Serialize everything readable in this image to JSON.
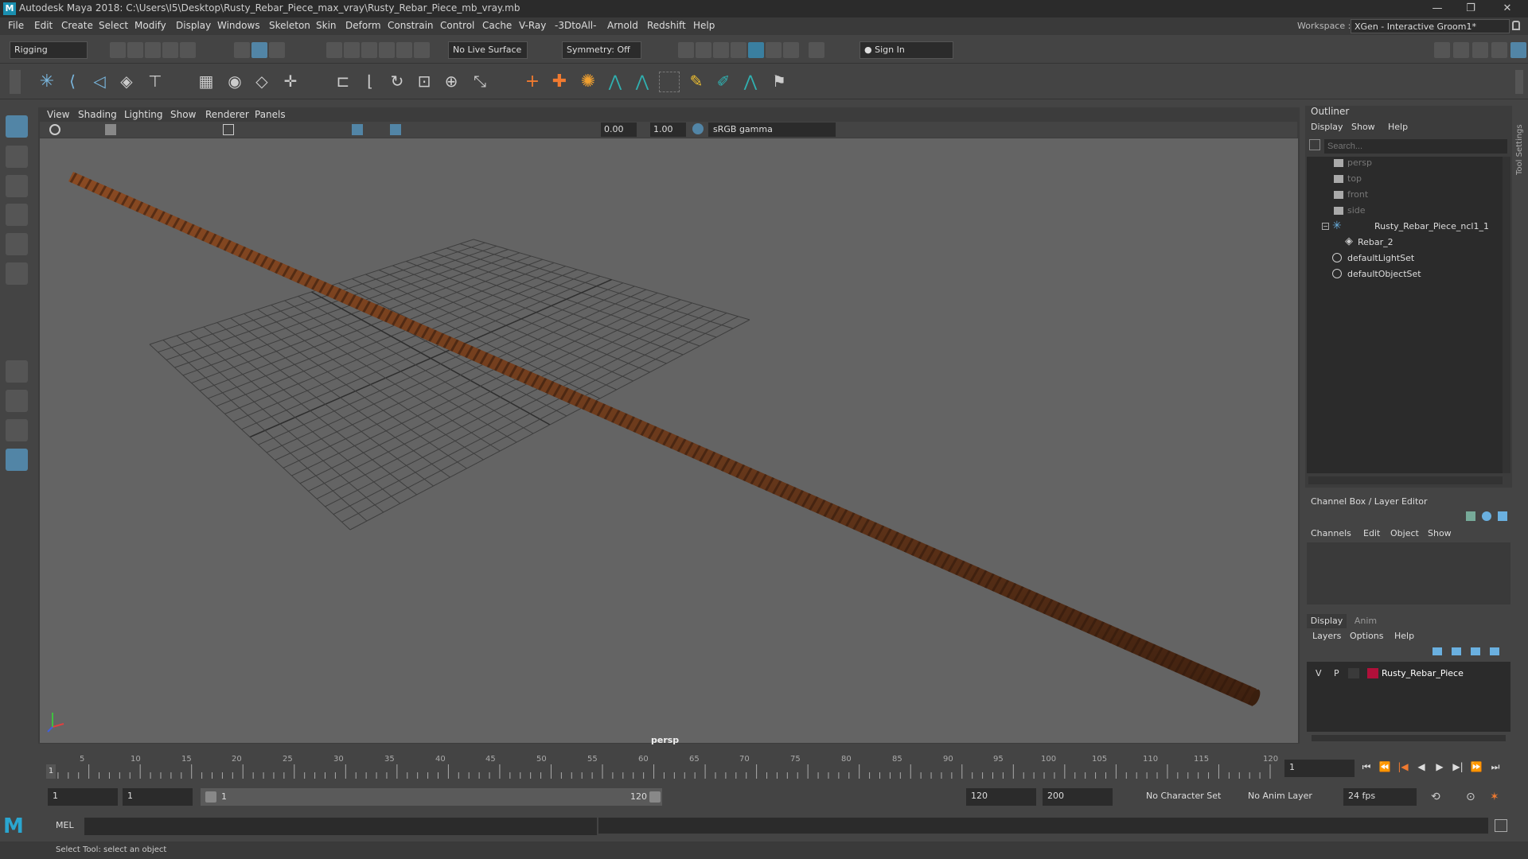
{
  "app": {
    "title": "Autodesk Maya 2018: C:\\Users\\I5\\Desktop\\Rusty_Rebar_Piece_max_vray\\Rusty_Rebar_Piece_mb_vray.mb",
    "window_buttons": [
      "—",
      "❐",
      "✕"
    ]
  },
  "menubar": {
    "items": [
      "File",
      "Edit",
      "Create",
      "Select",
      "Modify",
      "Display",
      "Windows",
      "Skeleton",
      "Skin",
      "Deform",
      "Constrain",
      "Control",
      "Cache",
      "V-Ray",
      "-3DtoAll-",
      "Arnold",
      "Redshift",
      "Help"
    ],
    "workspace_label": "Workspace :",
    "workspace_value": "XGen - Interactive Groom1*"
  },
  "statusline": {
    "mode": "Rigging",
    "live_surface": "No Live Surface",
    "symmetry": "Symmetry: Off",
    "sign_in": "Sign In"
  },
  "viewport": {
    "menus": [
      "View",
      "Shading",
      "Lighting",
      "Show",
      "Renderer",
      "Panels"
    ],
    "exposure": "0.00",
    "gamma": "1.00",
    "color_space": "sRGB gamma",
    "camera_label": "persp"
  },
  "outliner": {
    "title": "Outliner",
    "menus": [
      "Display",
      "Show",
      "Help"
    ],
    "search_placeholder": "Search...",
    "items": [
      {
        "label": "persp",
        "dim": true
      },
      {
        "label": "top",
        "dim": true
      },
      {
        "label": "front",
        "dim": true
      },
      {
        "label": "side",
        "dim": true
      },
      {
        "label": "Rusty_Rebar_Piece_ncl1_1",
        "dim": false
      },
      {
        "label": "Rebar_2",
        "dim": false
      },
      {
        "label": "defaultLightSet",
        "dim": false
      },
      {
        "label": "defaultObjectSet",
        "dim": false
      }
    ]
  },
  "channel_box": {
    "title": "Channel Box / Layer Editor",
    "menus": [
      "Channels",
      "Edit",
      "Object",
      "Show"
    ]
  },
  "layer_editor": {
    "tabs": [
      "Display",
      "Anim"
    ],
    "menus": [
      "Layers",
      "Options",
      "Help"
    ],
    "layer": {
      "v": "V",
      "p": "P",
      "name": "Rusty_Rebar_Piece",
      "color": "#b0103a"
    }
  },
  "side_tab": "Tool Settings",
  "timeline": {
    "ticks": [
      "5",
      "10",
      "15",
      "20",
      "25",
      "30",
      "35",
      "40",
      "45",
      "50",
      "55",
      "60",
      "65",
      "70",
      "75",
      "80",
      "85",
      "90",
      "95",
      "100",
      "105",
      "110",
      "115",
      "120"
    ],
    "start_marker": "1",
    "current_frame": "1",
    "playback_icons": [
      "⏮",
      "⏪",
      "|◀",
      "◀",
      "▶",
      "▶|",
      "⏩",
      "⏭"
    ]
  },
  "range": {
    "start": "1",
    "playback_start": "1",
    "slider_start": "1",
    "slider_end": "120",
    "playback_end": "120",
    "end": "200",
    "character_set": "No Character Set",
    "anim_layer": "No Anim Layer",
    "fps": "24 fps"
  },
  "command": {
    "lang": "MEL"
  },
  "help_line": "Select Tool: select an object",
  "colors": {
    "rebar": "#6b3a1c",
    "accent": "#5285a6"
  }
}
